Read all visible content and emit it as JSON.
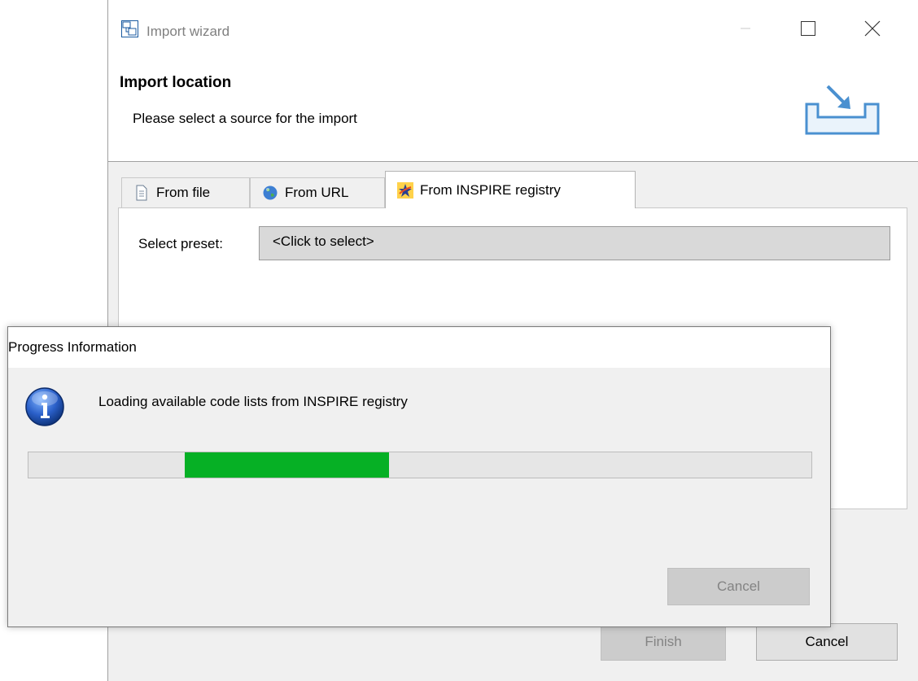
{
  "wizard": {
    "title": "Import wizard",
    "header_title": "Import location",
    "header_description": "Please select a source for the import",
    "tabs": [
      {
        "label": "From file",
        "icon": "document-icon",
        "selected": false
      },
      {
        "label": "From URL",
        "icon": "globe-icon",
        "selected": false
      },
      {
        "label": "From INSPIRE registry",
        "icon": "inspire-star-icon",
        "selected": true
      }
    ],
    "preset": {
      "label": "Select preset:",
      "value": "<Click to select>"
    },
    "buttons": {
      "finish": "Finish",
      "cancel": "Cancel"
    }
  },
  "progress_dialog": {
    "title": "Progress Information",
    "message": "Loading available code lists from INSPIRE registry",
    "progress": {
      "indeterminate": true,
      "fill_start": 0.2,
      "fill_end": 0.46,
      "color": "#06b025"
    },
    "cancel_label": "Cancel"
  }
}
